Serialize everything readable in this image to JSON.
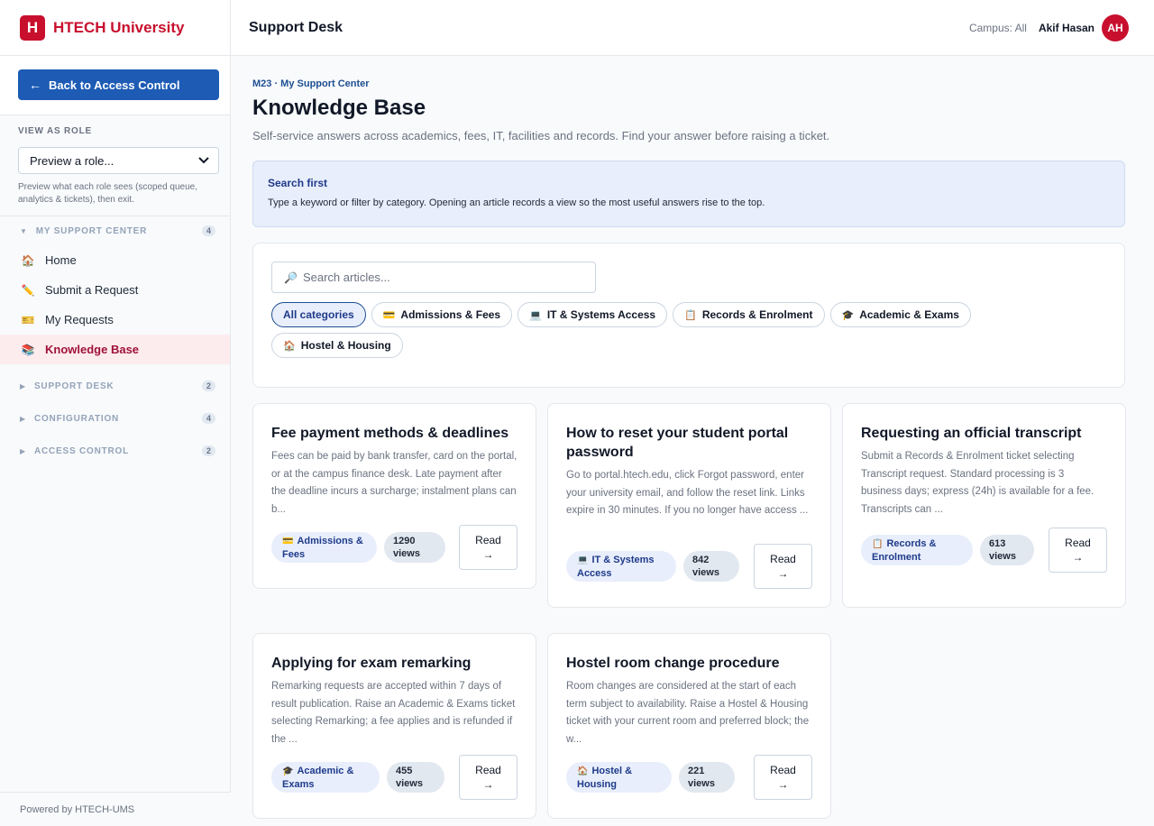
{
  "brand": {
    "logo_letter": "H",
    "name": "HTECH University"
  },
  "sidebar": {
    "back_label": "Back to Access Control",
    "back_arrow": "←",
    "role_label": "VIEW AS ROLE",
    "role_select_value": "Preview a role...",
    "role_help": "Preview what each role sees (scoped queue, analytics & tickets), then exit.",
    "groups": [
      {
        "label": "MY SUPPORT CENTER",
        "count": "4",
        "expanded": true,
        "items": [
          {
            "label": "Home",
            "icon": "🏠",
            "icon_name": "home-icon"
          },
          {
            "label": "Submit a Request",
            "icon": "✏️",
            "icon_name": "pencil-icon"
          },
          {
            "label": "My Requests",
            "icon": "🎫",
            "icon_name": "ticket-icon"
          },
          {
            "label": "Knowledge Base",
            "icon": "📚",
            "icon_name": "books-icon",
            "active": true
          }
        ]
      },
      {
        "label": "SUPPORT DESK",
        "count": "2",
        "expanded": false
      },
      {
        "label": "CONFIGURATION",
        "count": "4",
        "expanded": false
      },
      {
        "label": "ACCESS CONTROL",
        "count": "2",
        "expanded": false
      }
    ],
    "footer": "Powered by HTECH-UMS"
  },
  "topbar": {
    "title": "Support Desk",
    "campus": "Campus: All",
    "user_name": "Akif Hasan",
    "avatar_initials": "AH"
  },
  "main": {
    "eyebrow": "M23 · My Support Center",
    "title": "Knowledge Base",
    "subtitle": "Self-service answers across academics, fees, IT, facilities and records. Find your answer before raising a ticket.",
    "info": {
      "title": "Search first",
      "text": "Type a keyword or filter by category. Opening an article records a view so the most useful answers rise to the top."
    },
    "search_placeholder": "Search articles...",
    "categories": [
      {
        "label": "All categories",
        "icon": "",
        "active": true
      },
      {
        "label": "Admissions & Fees",
        "icon": "💳"
      },
      {
        "label": "IT & Systems Access",
        "icon": "💻"
      },
      {
        "label": "Records & Enrolment",
        "icon": "📋"
      },
      {
        "label": "Academic & Exams",
        "icon": "🎓"
      },
      {
        "label": "Hostel & Housing",
        "icon": "🏠"
      }
    ],
    "articles": [
      {
        "title": "Fee payment methods & deadlines",
        "excerpt": "Fees can be paid by bank transfer, card on the portal, or at the campus finance desk. Late payment after the deadline incurs a surcharge; instalment plans can b...",
        "category": "Admissions & Fees",
        "category_icon": "💳",
        "views": "1290 views",
        "read_label": "Read",
        "read_arrow": "→"
      },
      {
        "title": "How to reset your student portal password",
        "excerpt": "Go to portal.htech.edu, click Forgot password, enter your university email, and follow the reset link. Links expire in 30 minutes. If you no longer have access ...",
        "category": "IT & Systems Access",
        "category_icon": "💻",
        "views": "842 views",
        "read_label": "Read",
        "read_arrow": "→"
      },
      {
        "title": "Requesting an official transcript",
        "excerpt": "Submit a Records & Enrolment ticket selecting Transcript request. Standard processing is 3 business days; express (24h) is available for a fee. Transcripts can ...",
        "category": "Records & Enrolment",
        "category_icon": "📋",
        "views": "613 views",
        "read_label": "Read",
        "read_arrow": "→"
      },
      {
        "title": "Applying for exam remarking",
        "excerpt": "Remarking requests are accepted within 7 days of result publication. Raise an Academic & Exams ticket selecting Remarking; a fee applies and is refunded if the ...",
        "category": "Academic & Exams",
        "category_icon": "🎓",
        "views": "455 views",
        "read_label": "Read",
        "read_arrow": "→"
      },
      {
        "title": "Hostel room change procedure",
        "excerpt": "Room changes are considered at the start of each term subject to availability. Raise a Hostel & Housing ticket with your current room and preferred block; the w...",
        "category": "Hostel & Housing",
        "category_icon": "🏠",
        "views": "221 views",
        "read_label": "Read",
        "read_arrow": "→"
      }
    ]
  },
  "colors": {
    "brand_red": "#c8102e",
    "primary_blue": "#1d5bb5",
    "active_bg": "#fdecee"
  }
}
